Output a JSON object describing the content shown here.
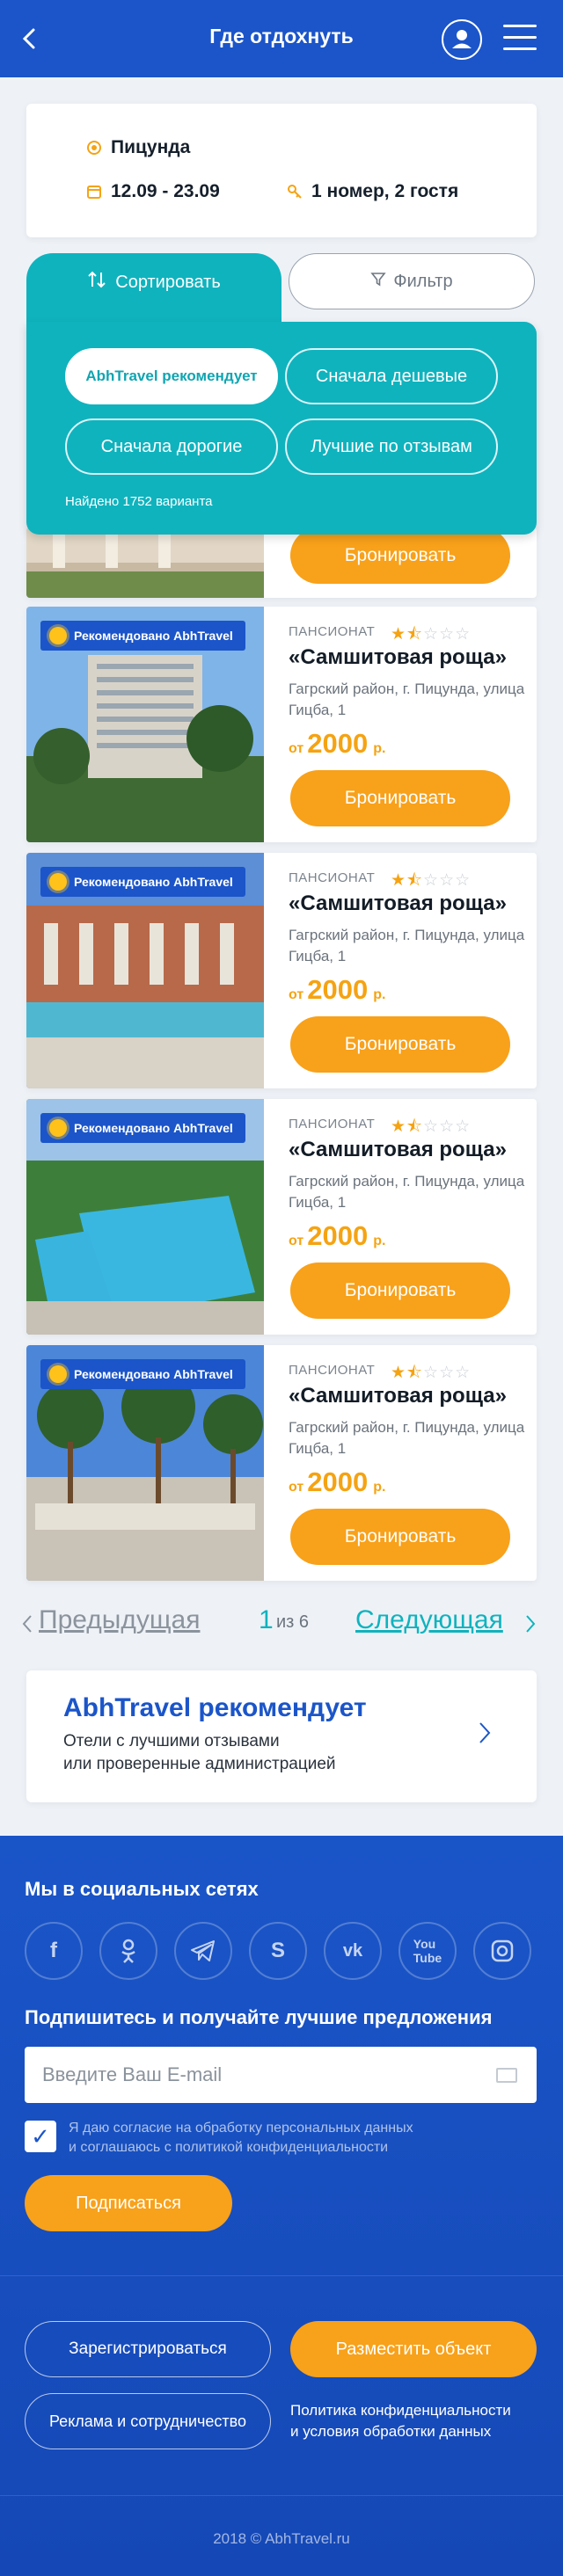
{
  "header": {
    "title": "Где отдохнуть",
    "back_icon": "back-arrow-icon",
    "user_icon": "user-icon",
    "menu_icon": "hamburger-menu-icon"
  },
  "search": {
    "city": "Пицунда",
    "dates": "12.09 - 23.09",
    "guests": "1 номер, 2 гостя"
  },
  "sort": {
    "label": "Сортировать",
    "filter_label": "Фильтр",
    "options": [
      "AbhTravel рекомендует",
      "Сначала дешевые",
      "Сначала дорогие",
      "Лучшие по отзывам"
    ],
    "active_index": 0,
    "found_text": "Найдено 1752 варианта"
  },
  "first_card_book_label": "Бронировать",
  "hotels": [
    {
      "badge": "Рекомендовано AbhTravel",
      "type": "ПАНСИОНАТ",
      "stars": 1.5,
      "name": "«Самшитовая роща»",
      "address": "Гагрский район, г. Пицунда, улица Гицба, 1",
      "price_from": "от",
      "price": "2000",
      "currency": "р.",
      "book_label": "Бронировать"
    },
    {
      "badge": "Рекомендовано AbhTravel",
      "type": "ПАНСИОНАТ",
      "stars": 1.5,
      "name": "«Самшитовая роща»",
      "address": "Гагрский район, г. Пицунда, улица Гицба, 1",
      "price_from": "от",
      "price": "2000",
      "currency": "р.",
      "book_label": "Бронировать"
    },
    {
      "badge": "Рекомендовано AbhTravel",
      "type": "ПАНСИОНАТ",
      "stars": 1.5,
      "name": "«Самшитовая роща»",
      "address": "Гагрский район, г. Пицунда, улица Гицба, 1",
      "price_from": "от",
      "price": "2000",
      "currency": "р.",
      "book_label": "Бронировать"
    },
    {
      "badge": "Рекомендовано AbhTravel",
      "type": "ПАНСИОНАТ",
      "stars": 1.5,
      "name": "«Самшитовая роща»",
      "address": "Гагрский район, г. Пицунда, улица Гицба, 1",
      "price_from": "от",
      "price": "2000",
      "currency": "р.",
      "book_label": "Бронировать"
    }
  ],
  "pagination": {
    "prev": "Предыдущая",
    "current": "1",
    "of": "из 6",
    "next": "Следующая"
  },
  "recommend": {
    "title": "AbhTravel рекомендует",
    "line1": "Отели с лучшими отзывами",
    "line2": "или проверенные администрацией"
  },
  "footer": {
    "social_title": "Мы в социальных сетях",
    "social": [
      "facebook-icon",
      "odnoklassniki-icon",
      "telegram-icon",
      "skype-icon",
      "vk-icon",
      "youtube-icon",
      "instagram-icon"
    ],
    "subscribe_title": "Подпишитесь и получайте лучшие предложения",
    "email_placeholder": "Введите Ваш E-mail",
    "consent_line1": "Я даю согласие на обработку персональных данных",
    "consent_line2": "и соглашаюсь с политикой конфиденциальности",
    "subscribe_label": "Подписаться",
    "register_label": "Зарегистрироваться",
    "place_label": "Разместить объект",
    "ads_label": "Реклама и сотрудничество",
    "policy_line1": "Политика конфиденциальности",
    "policy_line2": "и условия обработки данных",
    "copyright": "2018 © AbhTravel.ru"
  },
  "colors": {
    "primary": "#1b55c9",
    "teal": "#0fb3be",
    "orange": "#f8a11a"
  }
}
